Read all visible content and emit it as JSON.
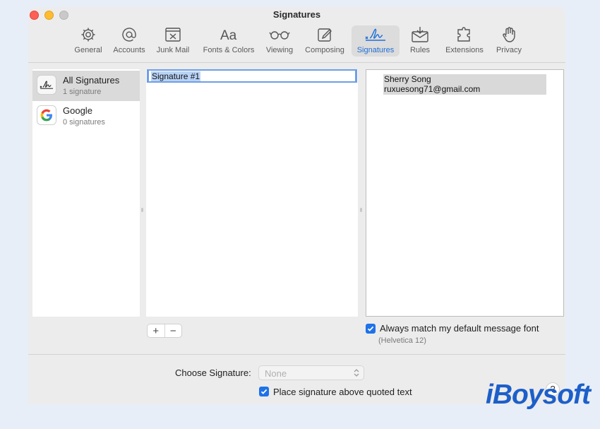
{
  "window": {
    "title": "Signatures"
  },
  "toolbar": {
    "items": [
      {
        "label": "General",
        "icon": "gear-icon"
      },
      {
        "label": "Accounts",
        "icon": "at-icon"
      },
      {
        "label": "Junk Mail",
        "icon": "junk-tray-icon"
      },
      {
        "label": "Fonts & Colors",
        "icon": "font-aa-icon"
      },
      {
        "label": "Viewing",
        "icon": "glasses-icon"
      },
      {
        "label": "Composing",
        "icon": "compose-icon"
      },
      {
        "label": "Signatures",
        "icon": "signature-icon",
        "active": true
      },
      {
        "label": "Rules",
        "icon": "rules-envelope-icon"
      },
      {
        "label": "Extensions",
        "icon": "puzzle-icon"
      },
      {
        "label": "Privacy",
        "icon": "hand-icon"
      }
    ],
    "active_color": "#1f6fd6"
  },
  "accounts": [
    {
      "name": "All Signatures",
      "count": "1 signature",
      "icon": "signature-icon",
      "selected": true
    },
    {
      "name": "Google",
      "count": "0 signatures",
      "icon": "google-icon"
    }
  ],
  "signatures": [
    {
      "name": "Signature #1"
    }
  ],
  "editor": {
    "lines": [
      "Sherry Song",
      "ruxuesong71@gmail.com"
    ]
  },
  "buttons": {
    "add": "+",
    "remove": "−"
  },
  "font_option": {
    "label": "Always match my default message font",
    "hint": "(Helvetica 12)",
    "checked": true
  },
  "choose": {
    "label": "Choose Signature:",
    "value": "None"
  },
  "place_above": {
    "label": "Place signature above quoted text",
    "checked": true
  },
  "help": {
    "label": "?"
  },
  "watermark": {
    "text": "iBoysoft",
    "color": "#1d5fc9"
  }
}
